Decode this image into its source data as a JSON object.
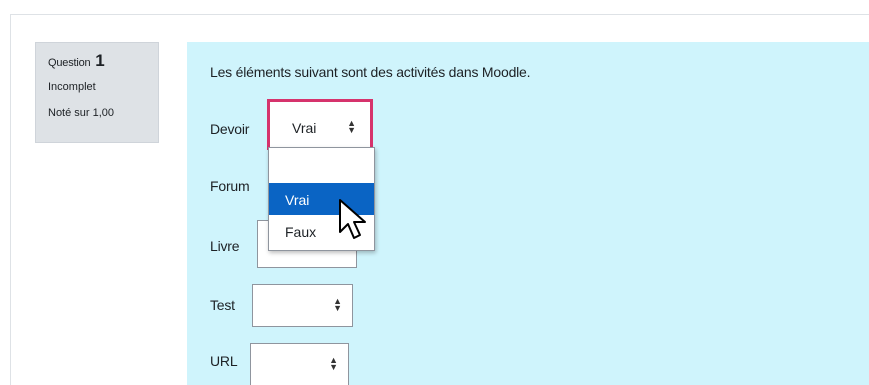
{
  "question_info": {
    "label": "Question",
    "number": "1",
    "state": "Incomplet",
    "grade": "Noté sur 1,00"
  },
  "question": {
    "text": "Les éléments suivant sont des activités dans Moodle.",
    "rows": [
      {
        "label": "Devoir",
        "selected": "Vrai"
      },
      {
        "label": "Forum",
        "selected": ""
      },
      {
        "label": "Livre",
        "selected": ""
      },
      {
        "label": "Test",
        "selected": ""
      },
      {
        "label": "URL",
        "selected": ""
      }
    ]
  },
  "dropdown": {
    "options": [
      "",
      "Vrai",
      "Faux"
    ],
    "highlighted": "Vrai"
  },
  "colors": {
    "content_bg": "#cff4fc",
    "info_bg": "#dee2e6",
    "focus_border": "#d6336c",
    "option_highlight": "#0a64c4"
  }
}
